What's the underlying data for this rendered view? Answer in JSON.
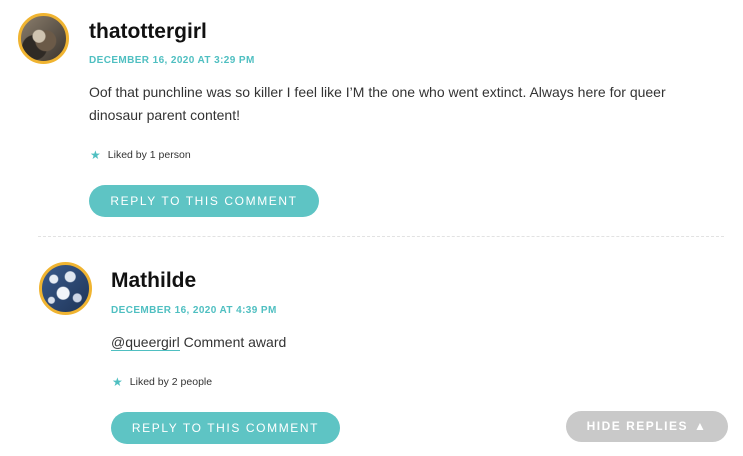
{
  "comments": [
    {
      "author": "thatottergirl",
      "date": "DECEMBER 16, 2020 AT 3:29 PM",
      "text": "Oof that punchline was so killer I feel like I’M the one who went extinct. Always here for queer dinosaur parent content!",
      "likes": "Liked by 1 person",
      "reply_label": "REPLY TO THIS COMMENT"
    },
    {
      "author": "Mathilde",
      "date": "DECEMBER 16, 2020 AT 4:39 PM",
      "mention": "@queergirl",
      "text": " Comment award",
      "likes": "Liked by 2 people",
      "reply_label": "REPLY TO THIS COMMENT"
    }
  ],
  "hide_replies_label": "HIDE REPLIES",
  "icons": {
    "like": "star-icon",
    "hide": "triangle-up-icon"
  },
  "colors": {
    "accent": "#4fbfc1",
    "avatar_ring": "#f0b431",
    "hide_button": "#c9c9c9"
  }
}
